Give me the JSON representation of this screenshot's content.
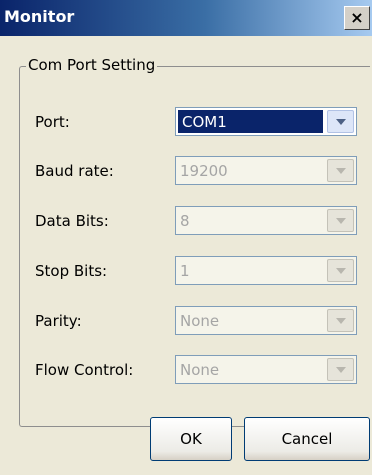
{
  "window": {
    "title": "Monitor",
    "close_label": "×"
  },
  "group": {
    "legend": "Com Port Setting"
  },
  "fields": {
    "port": {
      "label": "Port:",
      "value": "COM1",
      "enabled": true
    },
    "baud_rate": {
      "label": "Baud rate:",
      "value": "19200",
      "enabled": false
    },
    "data_bits": {
      "label": "Data Bits:",
      "value": "8",
      "enabled": false
    },
    "stop_bits": {
      "label": "Stop Bits:",
      "value": "1",
      "enabled": false
    },
    "parity": {
      "label": "Parity:",
      "value": "None",
      "enabled": false
    },
    "flow_control": {
      "label": "Flow Control:",
      "value": "None",
      "enabled": false
    }
  },
  "buttons": {
    "ok": "OK",
    "cancel": "Cancel"
  },
  "colors": {
    "title_bar_start": "#0a246a",
    "title_bar_end": "#a6caf0",
    "dialog_bg": "#ece9d8",
    "selection": "#0a246a"
  },
  "icons": {
    "close": "close-icon",
    "dropdown": "chevron-down-icon"
  }
}
